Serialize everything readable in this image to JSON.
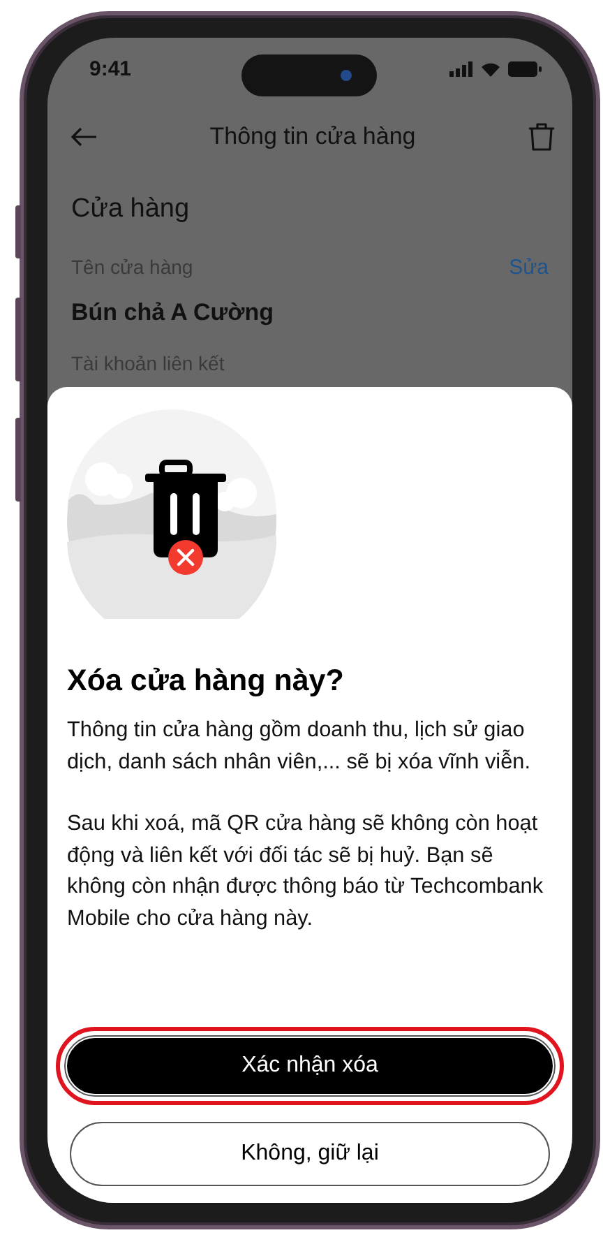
{
  "status_bar": {
    "time": "9:41"
  },
  "header": {
    "title": "Thông tin cửa hàng"
  },
  "section": {
    "title": "Cửa hàng",
    "fields": [
      {
        "label": "Tên cửa hàng",
        "action": "Sửa",
        "value": "Bún chả A Cường"
      },
      {
        "label": "Tài khoản liên kết"
      }
    ]
  },
  "dialog": {
    "title": "Xóa cửa hàng này?",
    "paragraphs": [
      "Thông tin cửa hàng gồm doanh thu, lịch sử giao dịch, danh sách nhân viên,... sẽ bị xóa vĩnh viễn.",
      "Sau khi xoá, mã QR cửa hàng sẽ không còn hoạt động và liên kết với đối tác sẽ bị huỷ. Bạn sẽ không còn nhận được thông báo từ Techcombank Mobile cho cửa hàng này."
    ],
    "buttons": [
      {
        "label": "Xác nhận xóa",
        "kind": "primary",
        "highlighted": true
      },
      {
        "label": "Không, giữ lại",
        "kind": "secondary",
        "highlighted": false
      }
    ]
  }
}
